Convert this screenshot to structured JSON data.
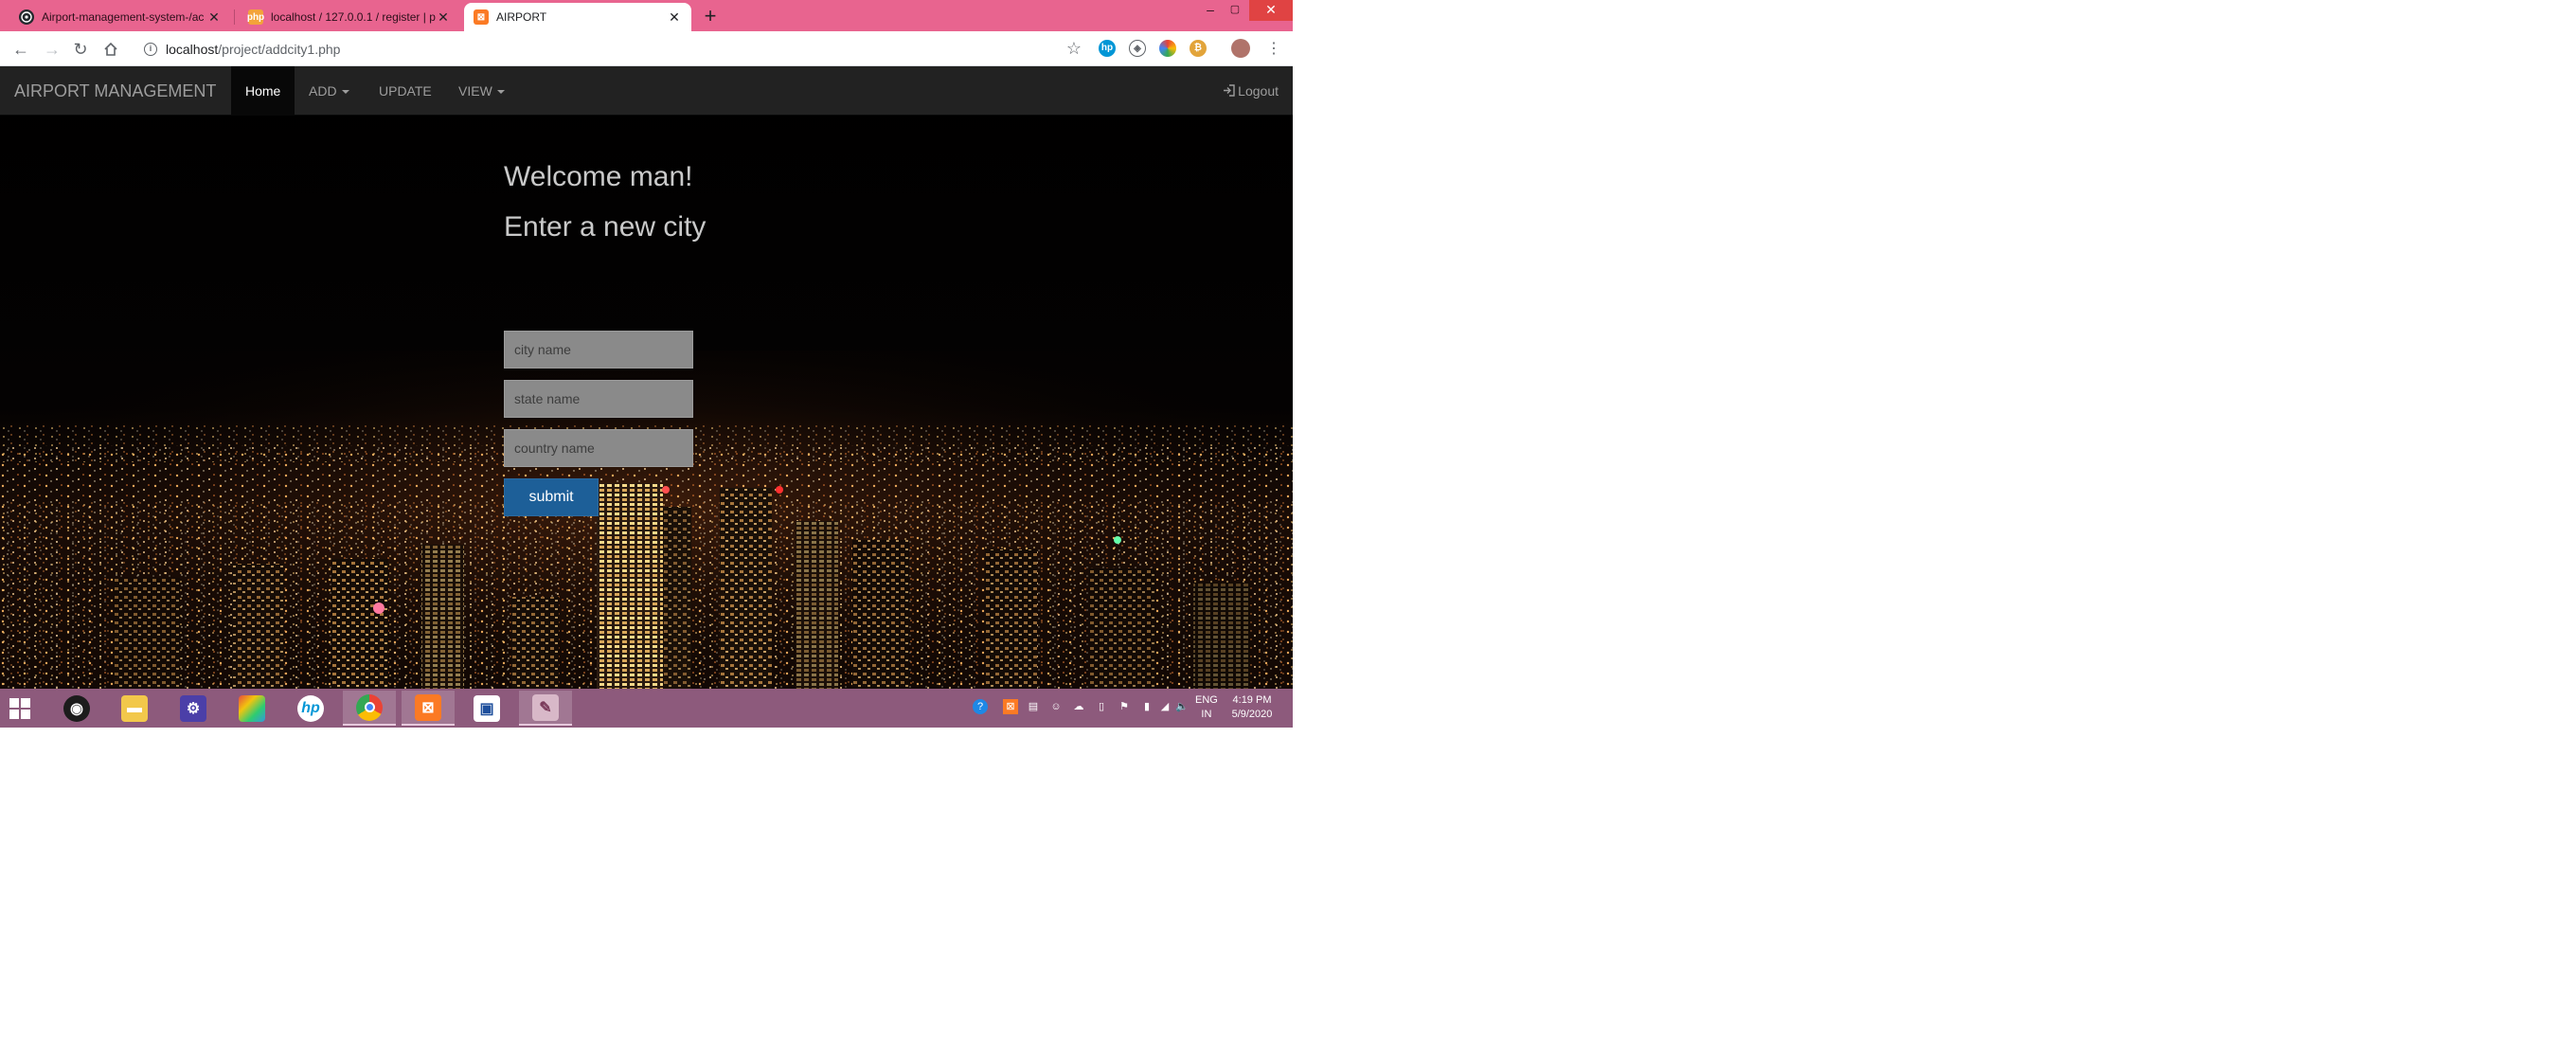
{
  "browser": {
    "tabs": [
      {
        "title": "Airport-management-system-/ac",
        "favicon": "github-icon",
        "active": false
      },
      {
        "title": "localhost / 127.0.0.1 / register | p",
        "favicon": "phpmyadmin-icon",
        "active": false
      },
      {
        "title": "AIRPORT",
        "favicon": "xampp-icon",
        "active": true
      }
    ],
    "new_tab": "+",
    "window_buttons": {
      "minimize": "–",
      "maximize": "▢",
      "close": "✕"
    },
    "url_host": "localhost",
    "url_path": "/project/addcity1.php",
    "extensions": [
      "hp-icon",
      "shield-icon",
      "colorful-icon",
      "coin-icon"
    ],
    "colors": {
      "tabbar": "#e8648f"
    }
  },
  "navbar": {
    "brand": "AIRPORT MANAGEMENT",
    "items": [
      {
        "label": "Home",
        "active": true,
        "dropdown": false
      },
      {
        "label": "ADD",
        "active": false,
        "dropdown": true
      },
      {
        "label": "UPDATE",
        "active": false,
        "dropdown": false
      },
      {
        "label": "VIEW",
        "active": false,
        "dropdown": true
      }
    ],
    "logout": "Logout"
  },
  "form": {
    "welcome": "Welcome man!",
    "title": "Enter a new city",
    "city_placeholder": "city name",
    "state_placeholder": "state name",
    "country_placeholder": "country name",
    "submit": "submit",
    "colors": {
      "submit": "#1d5f98"
    }
  },
  "taskbar": {
    "apps": [
      "start-icon",
      "camera-icon",
      "file-explorer-icon",
      "settings-icon",
      "photos-icon",
      "hp-icon",
      "chrome-icon",
      "xampp-icon",
      "app-icon",
      "paint-icon"
    ],
    "tray_icons": [
      "help-icon",
      "xampp-icon",
      "tray-icon",
      "tray-icon",
      "onedrive-icon",
      "battery-icon",
      "flag-icon",
      "network-icon",
      "wifi-icon",
      "volume-icon"
    ],
    "language": "ENG",
    "region": "IN",
    "time": "4:19 PM",
    "date": "5/9/2020"
  }
}
